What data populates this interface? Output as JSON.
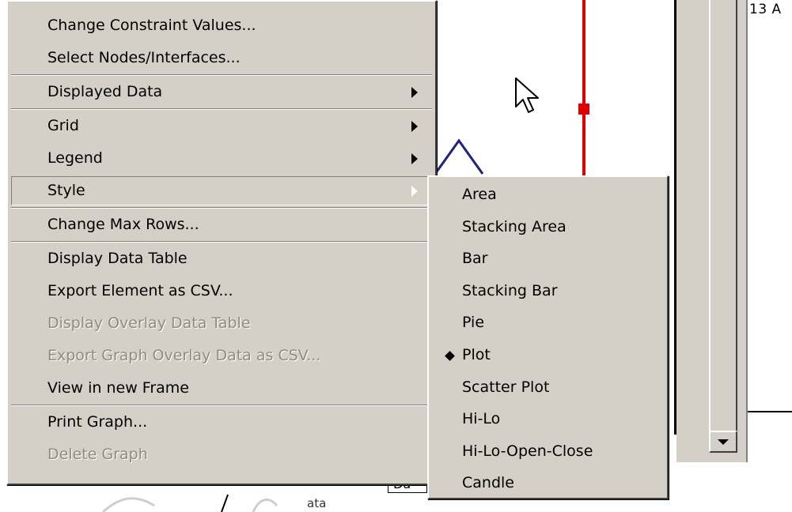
{
  "background": {
    "corner_text": "13 A",
    "bottom_label": "Da",
    "bottom_small_text": "ata"
  },
  "context_menu": {
    "items": [
      {
        "label": "Change Constraint Values...",
        "enabled": true
      },
      {
        "label": "Select Nodes/Interfaces...",
        "enabled": true
      },
      {
        "label": "Displayed Data",
        "enabled": true,
        "submenu": true
      },
      {
        "label": "Grid",
        "enabled": true,
        "submenu": true
      },
      {
        "label": "Legend",
        "enabled": true,
        "submenu": true
      },
      {
        "label": "Style",
        "enabled": true,
        "submenu": true,
        "active": true
      },
      {
        "label": "Change Max Rows...",
        "enabled": true
      },
      {
        "label": "Display Data Table",
        "enabled": true
      },
      {
        "label": "Export Element as CSV...",
        "enabled": true
      },
      {
        "label": "Display Overlay Data Table",
        "enabled": false
      },
      {
        "label": "Export Graph Overlay Data as CSV...",
        "enabled": false
      },
      {
        "label": "View in new Frame",
        "enabled": true
      },
      {
        "label": "Print Graph...",
        "enabled": true
      },
      {
        "label": "Delete Graph",
        "enabled": false
      }
    ]
  },
  "style_submenu": {
    "selected": "Plot",
    "items": [
      {
        "label": "Area"
      },
      {
        "label": "Stacking Area"
      },
      {
        "label": "Bar"
      },
      {
        "label": "Stacking Bar"
      },
      {
        "label": "Pie"
      },
      {
        "label": "Plot",
        "checked": true
      },
      {
        "label": "Scatter Plot"
      },
      {
        "label": "Hi-Lo"
      },
      {
        "label": "Hi-Lo-Open-Close"
      },
      {
        "label": "Candle"
      }
    ]
  },
  "colors": {
    "menu_face": "#d4d0c8",
    "disabled_text": "#8f8b83",
    "marker_line": "#e00000",
    "curve": "#1a237e"
  }
}
